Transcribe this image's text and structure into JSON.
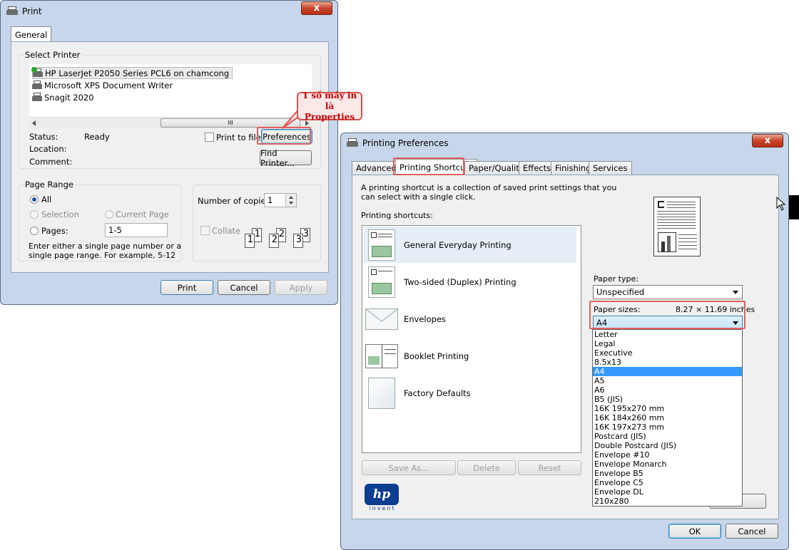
{
  "print_dialog": {
    "title": "Print",
    "close_label": "x",
    "tab_general": "General",
    "select_printer_label": "Select Printer",
    "printers": [
      {
        "name": "HP LaserJet P2050 Series PCL6 on chamcong"
      },
      {
        "name": "Microsoft XPS Document Writer"
      },
      {
        "name": "Snagit 2020"
      }
    ],
    "scroll_grip": "III",
    "status_label": "Status:",
    "status_value": "Ready",
    "location_label": "Location:",
    "comment_label": "Comment:",
    "print_to_file_label": "Print to file",
    "preferences_button": "Preferences",
    "find_printer_button": "Find Printer...",
    "page_range_label": "Page Range",
    "range_all": "All",
    "range_selection": "Selection",
    "range_current_page": "Current Page",
    "range_pages": "Pages:",
    "pages_value": "1-5",
    "range_hint": "Enter either a single page number or a single page range.  For example, 5-12",
    "copies_label": "Number of copies:",
    "copies_value": "1",
    "collate_label": "Collate",
    "collate_pages": [
      "1",
      "1",
      "2",
      "2",
      "3",
      "3"
    ],
    "print_button": "Print",
    "cancel_button": "Cancel",
    "apply_button": "Apply"
  },
  "callout": {
    "line1": "1 số máy in là",
    "line2": "Properties"
  },
  "prefs_dialog": {
    "title": "Printing Preferences",
    "close_label": "x",
    "tabs": [
      {
        "label": "Advanced"
      },
      {
        "label": "Printing Shortcuts"
      },
      {
        "label": "Paper/Quality"
      },
      {
        "label": "Effects"
      },
      {
        "label": "Finishing"
      },
      {
        "label": "Services"
      }
    ],
    "description": "A printing shortcut is a collection of saved print settings that you can select with a single click.",
    "shortcuts_label": "Printing shortcuts:",
    "shortcuts": [
      {
        "label": "General Everyday Printing"
      },
      {
        "label": "Two-sided (Duplex) Printing"
      },
      {
        "label": "Envelopes"
      },
      {
        "label": "Booklet Printing"
      },
      {
        "label": "Factory Defaults"
      }
    ],
    "save_as_button": "Save As...",
    "delete_button": "Delete",
    "reset_button": "Reset",
    "paper_type_label": "Paper type:",
    "paper_type_value": "Unspecified",
    "paper_sizes_label": "Paper sizes:",
    "paper_sizes_dims": "8.27 × 11.69 inches",
    "paper_size_value": "A4",
    "paper_size_options": [
      "Letter",
      "Legal",
      "Executive",
      "8.5x13",
      "A4",
      "A5",
      "A6",
      "B5 (JIS)",
      "16K 195x270 mm",
      "16K 184x260 mm",
      "16K 197x273 mm",
      "Postcard (JIS)",
      "Double Postcard (JIS)",
      "Envelope #10",
      "Envelope Monarch",
      "Envelope B5",
      "Envelope C5",
      "Envelope DL",
      "210x280"
    ],
    "selected_index": 4,
    "logo_text": "hp",
    "logo_sub": "invent",
    "ok_button": "OK",
    "cancel_button": "Cancel"
  }
}
